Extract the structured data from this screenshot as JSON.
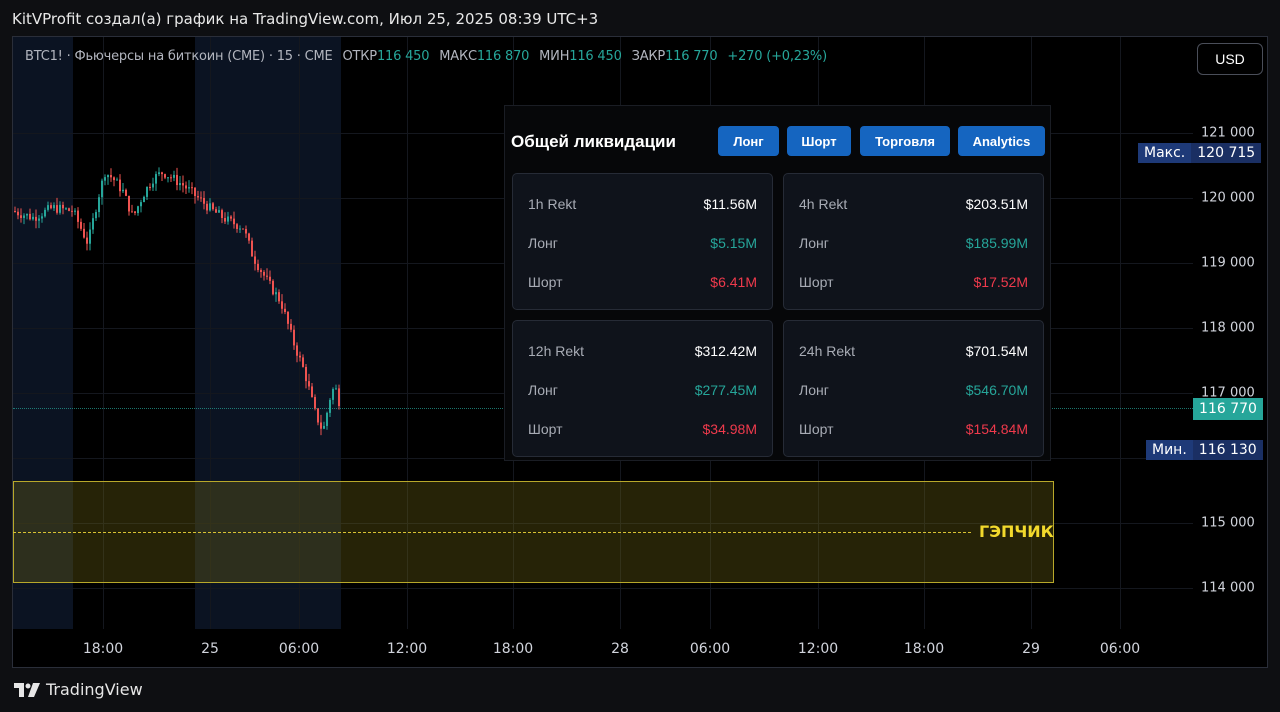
{
  "header": {
    "title": "KitVProfit создал(а) график на TradingView.com, Июл 25, 2025 08:39 UTC+3"
  },
  "symbol": {
    "name": "BTC1! · Фьючерсы на биткоин (CME) · 15 · CME",
    "open_label": "ОТКР",
    "open": "116 450",
    "high_label": "МАКС",
    "high": "116 870",
    "low_label": "МИН",
    "low": "116 450",
    "close_label": "ЗАКР",
    "close": "116 770",
    "change": "+270 (+0,23%)"
  },
  "currency_button": "USD",
  "price_axis": [
    "121 000",
    "120 000",
    "119 000",
    "118 000",
    "117 000",
    "115 000",
    "114 000"
  ],
  "time_axis": [
    "18:00",
    "25",
    "06:00",
    "12:00",
    "18:00",
    "28",
    "06:00",
    "12:00",
    "18:00",
    "29",
    "06:00"
  ],
  "max_label": {
    "key": "Макс.",
    "value": "120 715"
  },
  "min_label": {
    "key": "Мин.",
    "value": "116 130"
  },
  "last_price": "116 770",
  "gap_label": "ГЭПЧИК",
  "colors": {
    "up": "#26a69a",
    "down": "#ef5350",
    "accent": "#1565c0",
    "gap": "#f2d92c"
  },
  "liquidation": {
    "title": "Общей ликвидации",
    "buttons": [
      "Лонг",
      "Шорт",
      "Торговля",
      "Analytics"
    ],
    "cards": [
      {
        "period": "1h Rekt",
        "total": "$11.56M",
        "long_label": "Лонг",
        "long": "$5.15M",
        "short_label": "Шорт",
        "short": "$6.41M"
      },
      {
        "period": "4h Rekt",
        "total": "$203.51M",
        "long_label": "Лонг",
        "long": "$185.99M",
        "short_label": "Шорт",
        "short": "$17.52M"
      },
      {
        "period": "12h Rekt",
        "total": "$312.42M",
        "long_label": "Лонг",
        "long": "$277.45M",
        "short_label": "Шорт",
        "short": "$34.98M"
      },
      {
        "period": "24h Rekt",
        "total": "$701.54M",
        "long_label": "Лонг",
        "long": "$546.70M",
        "short_label": "Шорт",
        "short": "$154.84M"
      }
    ]
  },
  "footer": {
    "brand": "TradingView"
  }
}
